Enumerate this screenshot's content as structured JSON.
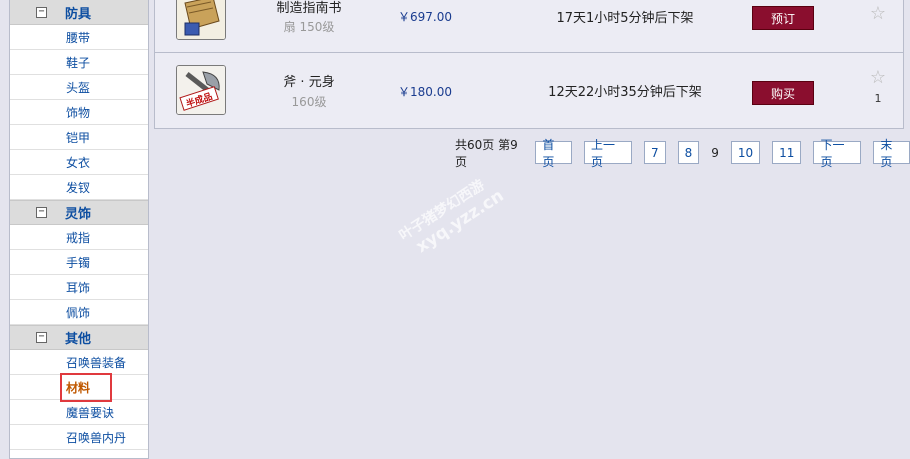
{
  "sidebar": {
    "categories": [
      {
        "title": "防具",
        "toggle": "−",
        "items": [
          "腰带",
          "鞋子",
          "头盔",
          "饰物",
          "铠甲",
          "女衣",
          "发钗"
        ]
      },
      {
        "title": "灵饰",
        "toggle": "−",
        "items": [
          "戒指",
          "手镯",
          "耳饰",
          "佩饰"
        ]
      },
      {
        "title": "其他",
        "toggle": "−",
        "items": [
          "召唤兽装备",
          "材料",
          "魔兽要诀",
          "召唤兽内丹"
        ]
      }
    ],
    "active_item": "材料"
  },
  "listings": [
    {
      "name": "制造指南书",
      "meta": "扇  150级",
      "price": "￥697.00",
      "remain": "17天1小时5分钟后下架",
      "action": "预订",
      "star_icon": "star-icon",
      "count": ""
    },
    {
      "name": "斧 · 元身",
      "meta": "160级",
      "price": "￥180.00",
      "remain": "12天22小时35分钟后下架",
      "action": "购买",
      "star_icon": "star-icon",
      "count": "1"
    }
  ],
  "pager": {
    "info": "共60页 第9页",
    "first": "首页",
    "prev": "上一页",
    "pages_before": [
      "7",
      "8"
    ],
    "current": "9",
    "pages_after": [
      "10",
      "11"
    ],
    "next": "下一页",
    "last": "末页"
  },
  "watermark": {
    "line1": "叶子猪梦幻西游",
    "line2": "xyq.yzz.cn"
  },
  "colors": {
    "button": "#8a0e2e",
    "link": "#0d4ea1",
    "active": "#c05800",
    "highlight_box": "#e0393e"
  }
}
